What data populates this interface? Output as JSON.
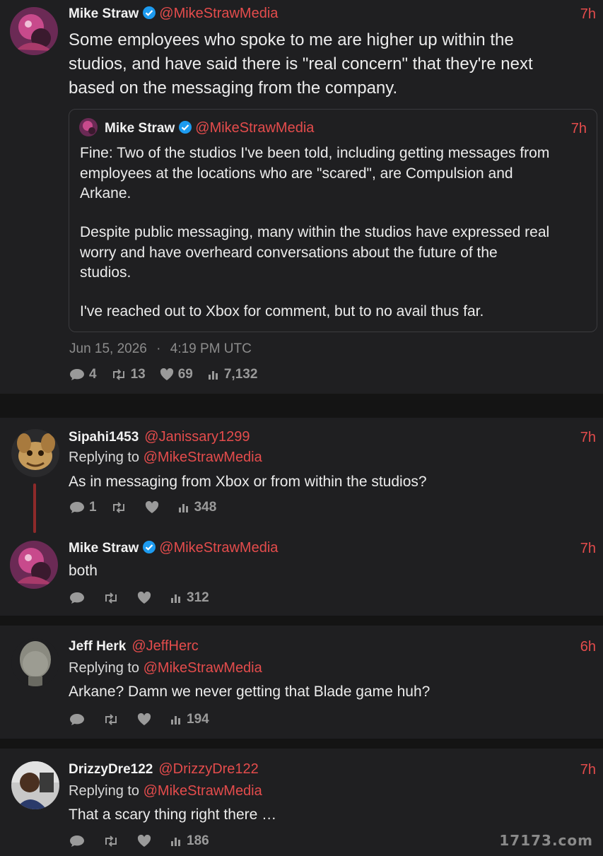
{
  "main_tweet": {
    "name": "Mike Straw",
    "handle": "@MikeStrawMedia",
    "time": "7h",
    "lines": [
      "Some employees who spoke to me are higher up within the",
      "studios, and have said there is \"real concern\" that they're next",
      "based on the messaging from the company."
    ],
    "quote": {
      "name": "Mike Straw",
      "handle": "@MikeStrawMedia",
      "time": "7h",
      "lines": [
        "Fine: Two of the studios I've been told, including getting messages from",
        "employees at the locations who are \"scared\", are Compulsion and",
        "Arkane.",
        "Despite public messaging, many within the studios have expressed real",
        "worry and have overheard conversations about the future of the",
        "studios.",
        "I've reached out to Xbox for comment, but to no avail thus far."
      ]
    },
    "date": "Jun 15, 2026",
    "dot": "·",
    "clock": "4:19 PM UTC",
    "stats": {
      "replies": "4",
      "retweets": "13",
      "likes": "69",
      "views": "7,132"
    }
  },
  "replies": [
    {
      "name": "Sipahi1453",
      "handle": "@Janissary1299",
      "time": "7h",
      "replying_label": "Replying to",
      "replying_handle": "@MikeStrawMedia",
      "text": "As in messaging from Xbox or from within the studios?",
      "stats": {
        "replies": "1",
        "retweets": "",
        "likes": "",
        "views": "348"
      }
    },
    {
      "name": "Mike Straw",
      "handle": "@MikeStrawMedia",
      "time": "7h",
      "text": "both",
      "stats": {
        "replies": "",
        "retweets": "",
        "likes": "",
        "views": "312"
      }
    },
    {
      "name": "Jeff Herk",
      "handle": "@JeffHerc",
      "time": "6h",
      "replying_label": "Replying to",
      "replying_handle": "@MikeStrawMedia",
      "text": "Arkane? Damn we never getting that Blade game huh?",
      "stats": {
        "replies": "",
        "retweets": "",
        "likes": "",
        "views": "194"
      }
    },
    {
      "name": "DrizzyDre122",
      "handle": "@DrizzyDre122",
      "time": "7h",
      "replying_label": "Replying to",
      "replying_handle": "@MikeStrawMedia",
      "text": "That a scary thing right there …",
      "stats": {
        "replies": "",
        "retweets": "",
        "likes": "",
        "views": "186"
      }
    }
  ],
  "watermark": "17173.com",
  "colors": {
    "accent": "#e44c4c",
    "verified": "#1d9bf0",
    "card": "#1f1f21",
    "background": "#141414"
  }
}
